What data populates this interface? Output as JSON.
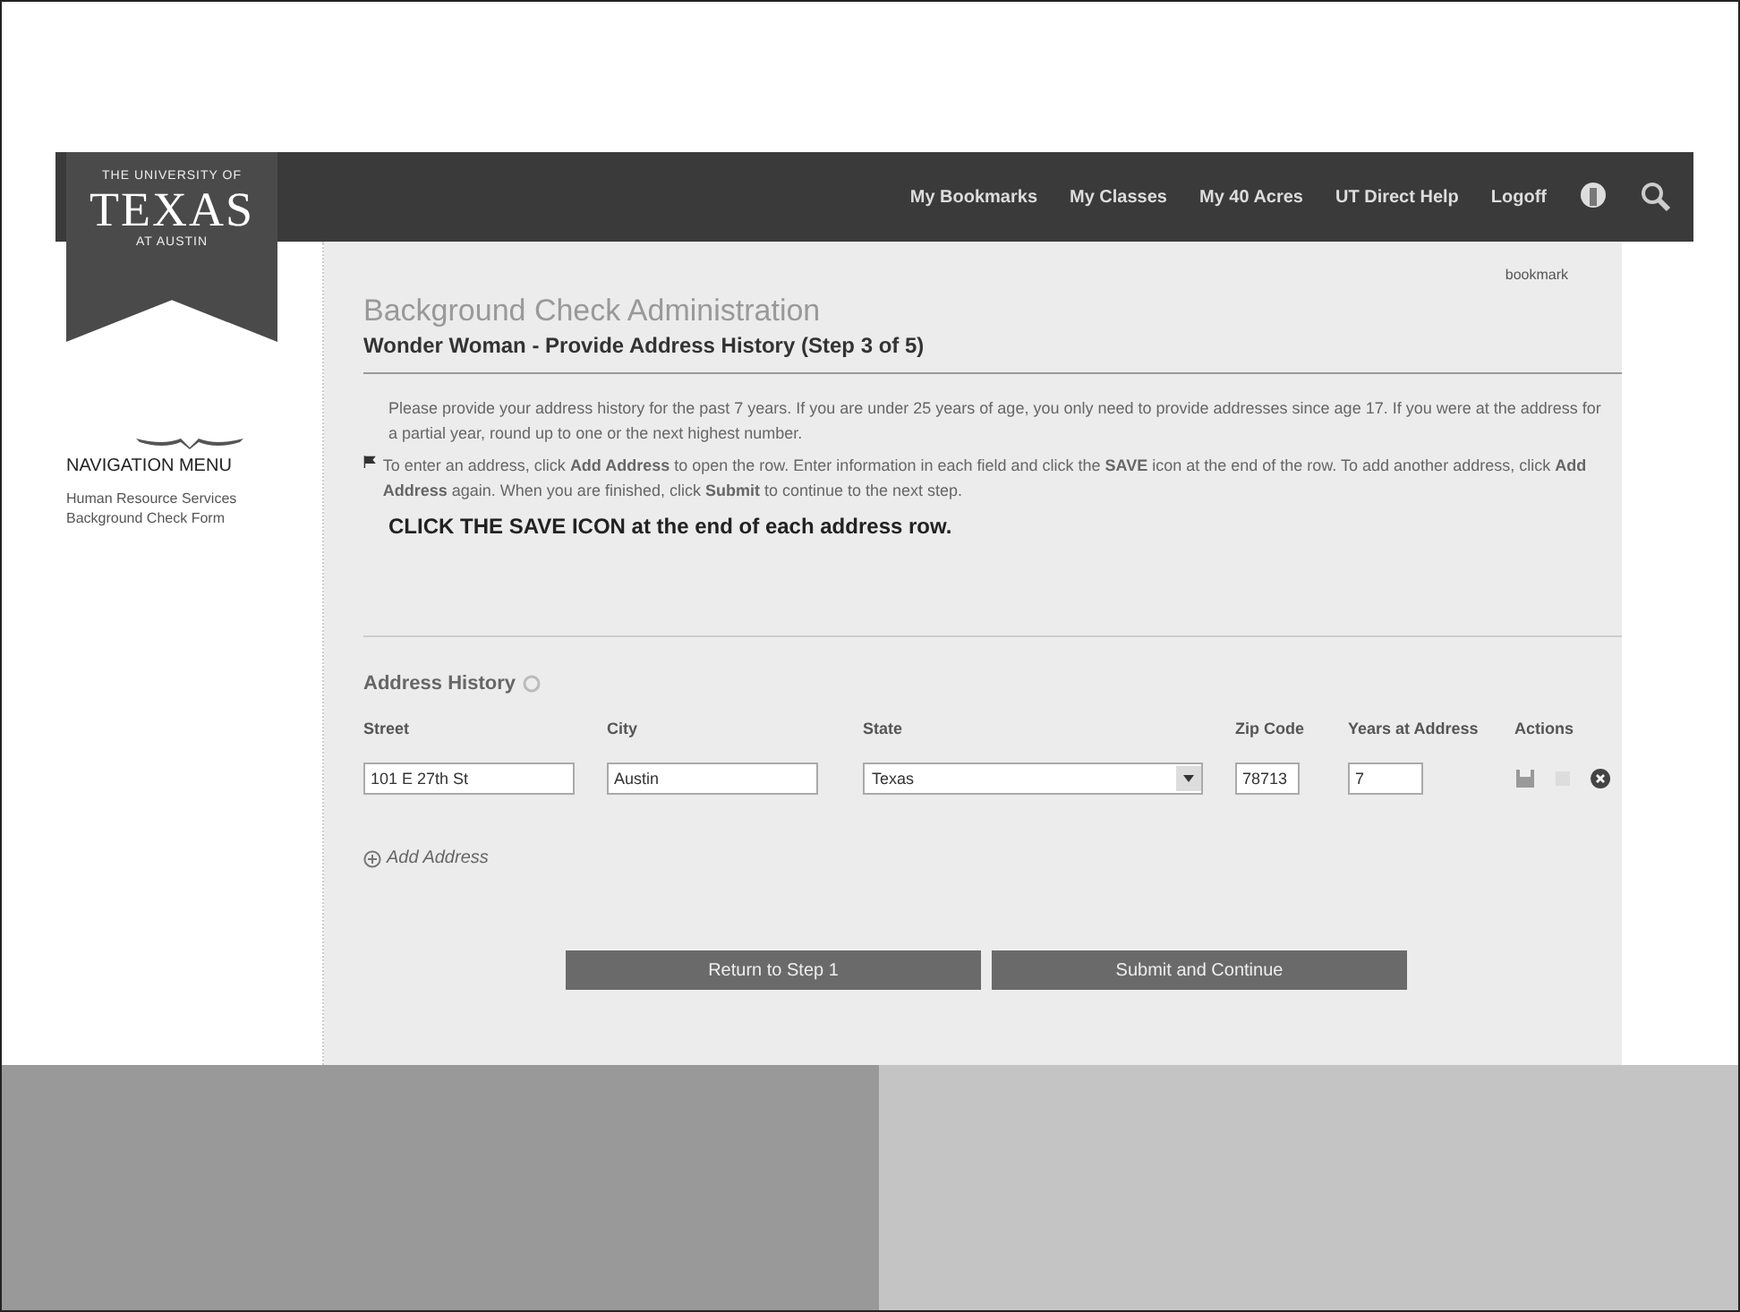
{
  "logo": {
    "top_line": "THE UNIVERSITY OF",
    "name": "TEXAS",
    "bottom_line": "AT AUSTIN"
  },
  "top_nav": {
    "links": [
      "My Bookmarks",
      "My Classes",
      "My 40 Acres",
      "UT Direct Help",
      "Logoff"
    ]
  },
  "sidebar": {
    "heading": "NAVIGATION MENU",
    "items": [
      "Human Resource Services",
      "Background Check Form"
    ]
  },
  "bookmark": "bookmark",
  "title": "Background Check Administration",
  "subtitle": "Wonder Woman - Provide Address History (Step 3 of 5)",
  "instructions": [
    "Please provide your address history for the past 7 years. If you are under 25 years of age, you only need to provide addresses since age 17. If you were at the address for a partial year, round up to one or the next highest number.",
    "To enter an address, click **Add Address** to open the row. Enter information in each field and click the **SAVE** icon at the end of the row. To add another address, click **Add Address** again. When you are finished, click **Submit** to continue to the next step."
  ],
  "notice": "CLICK THE SAVE ICON at the end of each address row.",
  "address_history": {
    "title": "Address History",
    "columns": [
      "Street",
      "City",
      "State",
      "Zip Code",
      "Years at Address",
      "Actions"
    ],
    "rows": [
      {
        "street": "101 E 27th St",
        "city": "Austin",
        "state": "Texas",
        "zip": "78713",
        "years": "7"
      }
    ],
    "add_link": "Add Address"
  },
  "buttons": [
    "Return to Step 1",
    "Submit and Continue"
  ]
}
